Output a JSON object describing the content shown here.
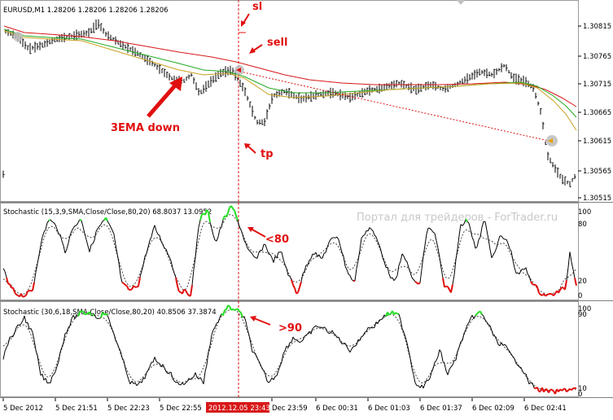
{
  "main": {
    "header": "EURUSD,M1  1.28206 1.28206 1.28206 1.28206",
    "y_ticks": [
      "1.30815",
      "1.30765",
      "1.30715",
      "1.30665",
      "1.30615",
      "1.30565",
      "1.30515"
    ],
    "annotations": {
      "sl": "sl",
      "sell": "sell",
      "ema": "3EMA down",
      "tp": "tp"
    },
    "colors": {
      "ema_slow": "#d81818",
      "ema_mid": "#22aa22",
      "ema_fast": "#c8a020",
      "vline": "#e01010"
    }
  },
  "stoch1": {
    "header": "Stochastic (15,3,9,SMA,Close/Close,80,20) 68.8037 13.0952",
    "watermark": "Портал для трейдеров - ForTrader.ru",
    "level_top": "100",
    "level_high": "80",
    "level_low": "20",
    "level_bottom": "0",
    "annotation": "<80"
  },
  "stoch2": {
    "header": "Stochastic (30,6,18,SMA,Close/Close,80,20) 40.8506 37.3874",
    "level_top": "100",
    "level_high": "90",
    "level_low": "10",
    "level_bottom": "0",
    "annotation": ">90"
  },
  "time_axis": {
    "labels": [
      "5 Dec 2012",
      "5 Dec 21:51",
      "5 Dec 22:23",
      "5 Dec 22:55",
      "2012.12.05 23:43",
      "Dec 23:59",
      "6 Dec 00:31",
      "6 Dec 01:03",
      "6 Dec 01:37",
      "6 Dec 02:09",
      "6 Dec 02:41"
    ],
    "highlight_color": "#d81818"
  }
}
